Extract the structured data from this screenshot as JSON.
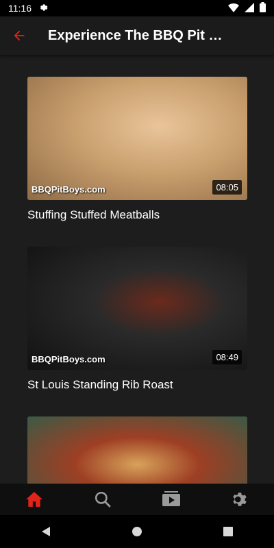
{
  "status_bar": {
    "time": "11:16"
  },
  "app_bar": {
    "title": "Experience The BBQ Pit Boy…",
    "accent_color": "#e0241b"
  },
  "videos": [
    {
      "title": "Stuffing Stuffed Meatballs",
      "duration": "08:05",
      "watermark": "BBQPitBoys.com"
    },
    {
      "title": "St Louis Standing Rib Roast",
      "duration": "08:49",
      "watermark": "BBQPitBoys.com"
    },
    {
      "title": "",
      "duration": "",
      "watermark": ""
    }
  ],
  "bottom_nav": {
    "items": [
      {
        "icon": "home-icon",
        "active": true
      },
      {
        "icon": "search-icon",
        "active": false
      },
      {
        "icon": "subscriptions-icon",
        "active": false
      },
      {
        "icon": "settings-icon",
        "active": false
      }
    ]
  },
  "system_nav": {
    "buttons": [
      "back-triangle-icon",
      "home-circle-icon",
      "recents-square-icon"
    ]
  }
}
